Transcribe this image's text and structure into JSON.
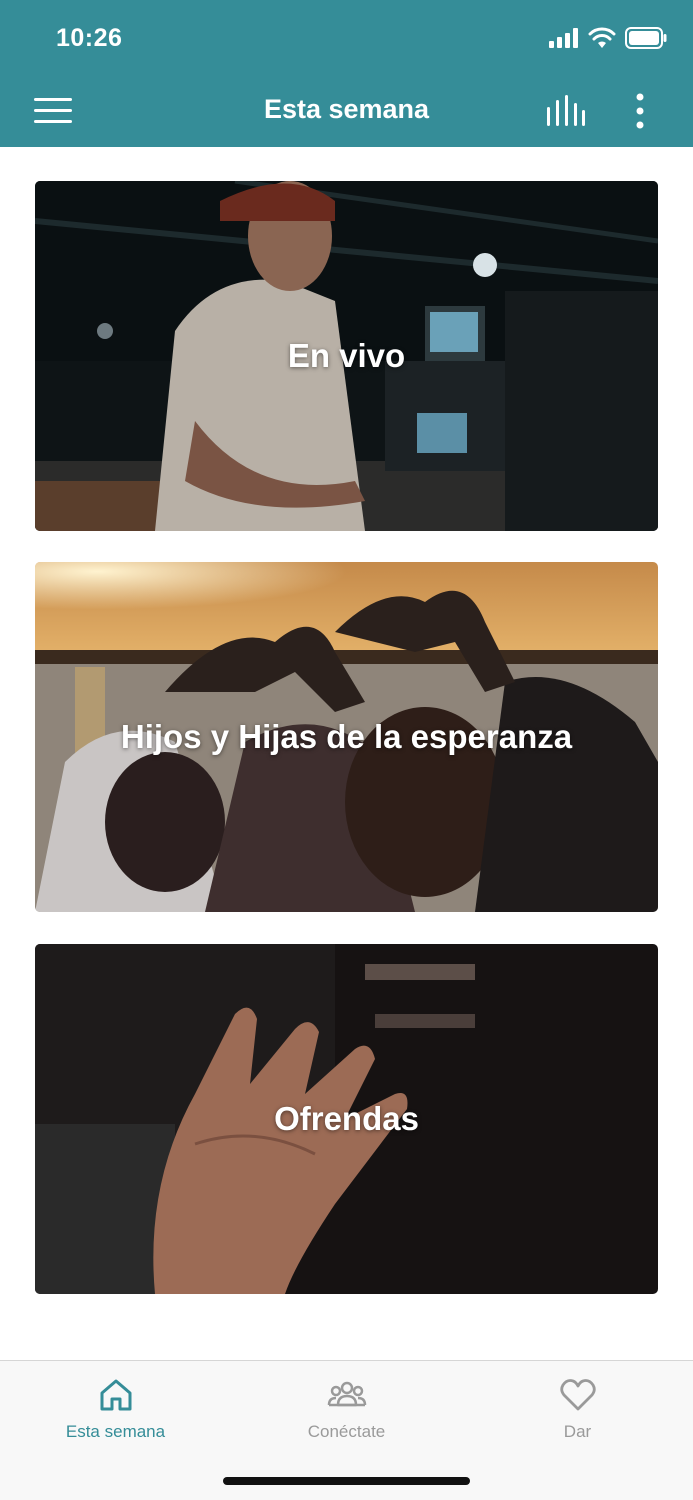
{
  "status_bar": {
    "time": "10:26"
  },
  "header": {
    "title": "Esta semana",
    "icons": [
      "menu-icon",
      "stats-icon",
      "more-vertical-icon"
    ]
  },
  "cards": [
    {
      "label": "En vivo"
    },
    {
      "label": "Hijos y Hijas de la esperanza"
    },
    {
      "label": "Ofrendas"
    }
  ],
  "bottom_nav": {
    "items": [
      {
        "label": "Esta semana",
        "icon": "home-icon",
        "active": true
      },
      {
        "label": "Conéctate",
        "icon": "people-icon",
        "active": false
      },
      {
        "label": "Dar",
        "icon": "heart-icon",
        "active": false
      }
    ]
  },
  "colors": {
    "accent": "#358d98",
    "inactive": "#9a9a9a"
  }
}
